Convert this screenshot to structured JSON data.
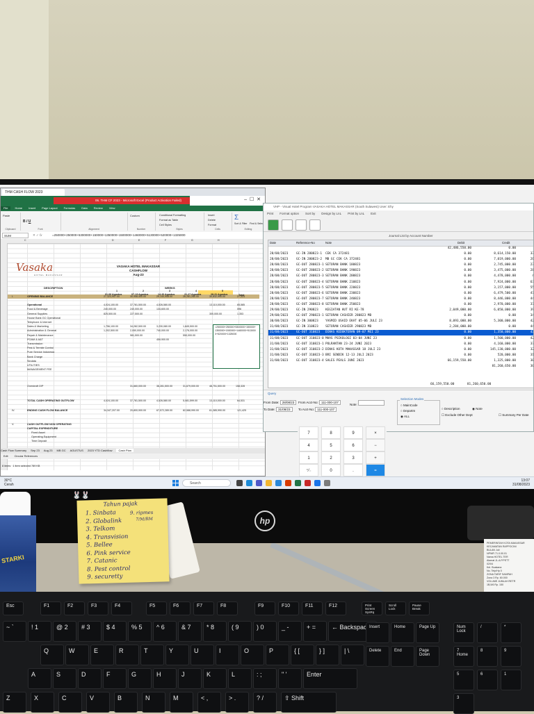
{
  "excel": {
    "tab_title": "THM CASH FLOW 2023",
    "window_title": "06. THM CF 2023 - Microsoft Excel (Product Activation Failed)",
    "ribbon_tabs": [
      "File",
      "Home",
      "Insert",
      "Page Layout",
      "Formulas",
      "Data",
      "Review",
      "View"
    ],
    "ribbon_groups": [
      "Clipboard",
      "Font",
      "Alignment",
      "Number",
      "Styles",
      "Cells",
      "Editing"
    ],
    "ribbon_buttons": {
      "paste": "Paste",
      "conditional": "Conditional Formatting",
      "format_table": "Format as Table",
      "cell_styles": "Cell Styles",
      "insert": "Insert",
      "delete": "Delete",
      "format": "Format",
      "sort": "Sort & Filter",
      "find": "Find & Select",
      "custom": "Custom"
    },
    "name_box": "SUM",
    "formula": "=250000+250000+5300000+150000+1350000+1500000+1460000+5130000+520000+1325000",
    "logo_text": "Vasaka",
    "logo_sub": "HOTEL MAKASSAR",
    "hotel_name": "VASAKA HOTEL MAKASSAR",
    "sheet_title": "CASHFLOW",
    "period": "Aug-23",
    "description_header": "DESCRIPTION",
    "weeks_header": "WEEKS",
    "week_ranges": [
      "01-06 Agustus",
      "07-13 Agustus",
      "14-20 Agustus",
      "21-27 Agustus",
      "28-31 Agustus",
      "Total"
    ],
    "week_numbers": [
      "1",
      "2",
      "3",
      "4",
      "5"
    ],
    "rows": [
      {
        "no": "I.",
        "label": "OPENING BALANCE",
        "v": [
          "27,323,907.00",
          "30,958,400.00",
          "29,140,908.00",
          "28,281,280.00",
          "30,832,990.00",
          "27,323"
        ]
      },
      {
        "no": "",
        "label": "Operational",
        "v": [
          "4,024,100.00",
          "37,781,500.00",
          "4,526,580.00",
          "",
          "13,110,000.00",
          "65,585"
        ]
      },
      {
        "no": "",
        "label": "Food & Beverage",
        "v": [
          "240,000.00",
          "240,000.00",
          "134,600.00",
          "",
          "",
          "596"
        ]
      },
      {
        "no": "",
        "label": "General Supplies",
        "v": [
          "825,500.00",
          "227,500.00",
          "",
          "",
          "300,000.00",
          "1,353"
        ]
      },
      {
        "no": "",
        "label": "House Bank GC Operational",
        "v": [
          "",
          "",
          "",
          "",
          "",
          ""
        ]
      },
      {
        "no": "",
        "label": "Telephone & Internet",
        "v": [
          "",
          "",
          "",
          "",
          "",
          ""
        ]
      },
      {
        "no": "",
        "label": "Sales & Marketing",
        "v": [
          "1,756,100.00",
          "34,282,500.00",
          "3,230,080.00",
          "1,845,500.00",
          "",
          ""
        ]
      },
      {
        "no": "",
        "label": "Administration & General",
        "v": [
          "1,202,500.00",
          "2,050,000.00",
          "740,000.00",
          "2,176,000.00",
          "",
          ""
        ]
      },
      {
        "no": "",
        "label": "Repair & Maintenance",
        "v": [
          "",
          "981,500.00",
          "",
          "550,000.00",
          "",
          ""
        ]
      },
      {
        "no": "",
        "label": "POAM & A&T",
        "v": [
          "",
          "",
          "459,900.00",
          "",
          "",
          ""
        ]
      },
      {
        "no": "",
        "label": "Transmission",
        "v": [
          "",
          "",
          "",
          "",
          "",
          ""
        ]
      },
      {
        "no": "",
        "label": "Pest & Termite Control",
        "v": [
          "",
          "",
          "",
          "",
          "",
          ""
        ]
      },
      {
        "no": "",
        "label": "Pure Service Indonesia",
        "v": [
          "",
          "",
          "",
          "",
          "",
          ""
        ]
      },
      {
        "no": "",
        "label": "Bank Charge",
        "v": [
          "",
          "",
          "",
          "",
          "",
          ""
        ]
      },
      {
        "no": "",
        "label": "Sindata",
        "v": [
          "",
          "",
          "",
          "",
          "",
          ""
        ]
      },
      {
        "no": "",
        "label": "UTILITIES",
        "v": [
          "",
          "",
          "",
          "",
          "",
          ""
        ]
      },
      {
        "no": "",
        "label": "MANAGEMENT FEE",
        "v": [
          "",
          "",
          "",
          "",
          "",
          ""
        ]
      }
    ],
    "cell_overlay": "=250000+250000+5300000+150000+1350000+1500000+1460000+5130000+520000+1325000",
    "overdraft_label": "Overdraft O/P",
    "overdraft_values": [
      "31,660,000.00",
      "38,281,500.00",
      "31,679,000.00",
      "48,751,500.00",
      "158,328"
    ],
    "total_out_label": "TOTAL CASH OPERATING OUTFLOW",
    "total_out_values": [
      "4,024,100.00",
      "37,781,500.00",
      "4,526,580.00",
      "5,081,599.00",
      "13,110,000.00",
      "64,531"
    ],
    "ending_label": "ENDING CASH FLOW BALANCE",
    "ending_no": "IV.",
    "ending_values": [
      "34,347,207.00",
      "20,800,900.00",
      "67,572,289.00",
      "82,588,990.00",
      "61,385,990.00",
      "121,425"
    ],
    "non_op_no": "V.",
    "non_op_lines": [
      "CASH OUTFLOW NON OPERATING",
      "CAPITAL EXPENDITURE",
      "Fixed Asset",
      "Operating Equipment",
      "Time Deposit"
    ],
    "sheet_tabs": [
      "Cash Flow Summary",
      "Sep 23",
      "Aug 23",
      "MB GC",
      "AGUSTUS",
      "2023 YTD Cashflow",
      "Cash Plan"
    ],
    "status_left": "Edit",
    "status_sheets": "Circular References",
    "status_items": "8 items",
    "status_selected": "1 item selected 789 KB"
  },
  "vhp": {
    "title": "VHP - Visual Hotel Program    VASAKA HOTEL MAKASSAR (South Sulawesi) User: Ehy",
    "menu": [
      "Print",
      "Format option",
      "Sort by",
      "Design by LnL",
      "Print by LnL",
      "Exit"
    ],
    "list_title": "Journal List by Account Number",
    "columns": [
      "Date",
      "Reference-No",
      "Note",
      "Debit",
      "Credit"
    ],
    "opening_debit": "42,486,550.00",
    "opening_credit": "0.00",
    "rows": [
      {
        "date": "28/08/2023",
        "ref": "GC-IN 280823-1",
        "note": "CEK CA 372481",
        "debit": "0.00",
        "credit": "8,614,150.00",
        "x": "33"
      },
      {
        "date": "28/08/2023",
        "ref": "GC-IN 280823-2",
        "note": "MB GC CEK CA 372481",
        "debit": "0.00",
        "credit": "7,019,000.00",
        "x": "26"
      },
      {
        "date": "28/08/2023",
        "ref": "GC-OUT 280823-1",
        "note": "SETORAN BANK 180823",
        "debit": "0.00",
        "credit": "2,745,000.00",
        "x": "23"
      },
      {
        "date": "28/08/2023",
        "ref": "GC-OUT 280823-2",
        "note": "SETORAN BANK 190823",
        "debit": "0.00",
        "credit": "3,475,000.00",
        "x": "28"
      },
      {
        "date": "28/08/2023",
        "ref": "GC-OUT 280823-3",
        "note": "SETORAN BANK 200823",
        "debit": "0.00",
        "credit": "4,478,000.00",
        "x": "4"
      },
      {
        "date": "28/08/2023",
        "ref": "GC-OUT 280823-4",
        "note": "SETORAN BANK 210823",
        "debit": "0.00",
        "credit": "7,924,000.00",
        "x": "63"
      },
      {
        "date": "28/08/2023",
        "ref": "GC-OUT 280823-5",
        "note": "SETORAN BANK 220823",
        "debit": "0.00",
        "credit": "3,157,000.00",
        "x": "55"
      },
      {
        "date": "28/08/2023",
        "ref": "GC-OUT 280823-6",
        "note": "SETORAN BANK 230823",
        "debit": "0.00",
        "credit": "6,479,500.00",
        "x": "47"
      },
      {
        "date": "28/08/2023",
        "ref": "GC-OUT 280823-7",
        "note": "SETORAN BANK 240823",
        "debit": "0.00",
        "credit": "8,446,000.00",
        "x": "44"
      },
      {
        "date": "28/08/2023",
        "ref": "GC-OUT 280823-8",
        "note": "SETORAN BANK 250823",
        "debit": "0.00",
        "credit": "2,970,000.00",
        "x": "37"
      },
      {
        "date": "29/08/2023",
        "ref": "GC-IN 290823",
        "note": "KEGIATAN HUT RI KE-78",
        "debit": "2,049,000.00",
        "credit": "6,050,000.00",
        "x": "39"
      },
      {
        "date": "29/08/2023",
        "ref": "GC-OUT 290823-1",
        "note": "SETORAN CASHIER 280823 MB",
        "debit": "0.00",
        "credit": "0.00",
        "x": "34"
      },
      {
        "date": "30/08/2023",
        "ref": "GC-IN 300823",
        "note": "YASMID USAID EKAT 05-06 JULI 23",
        "debit": "8,093,000.00",
        "credit": "5,300,000.00",
        "x": "42"
      },
      {
        "date": "31/08/2023",
        "ref": "GC-IN 310823",
        "note": "SETORAN CASHIER 290823 MB",
        "debit": "2,284,000.00",
        "credit": "0.00",
        "x": "44"
      },
      {
        "date": "31/08/2023",
        "ref": "GC-OUT 310823",
        "note": "DINAS KEDOKTERAN 09-07 MEI 23",
        "debit": "0.00",
        "credit": "1,350,000.00",
        "x": "43",
        "selected": true
      },
      {
        "date": "31/08/2023",
        "ref": "GC-OUT 310823-0",
        "note": "MHAS PSIKOLOGI 03-04 JUNI 23",
        "debit": "0.00",
        "credit": "1,500,000.00",
        "x": "42"
      },
      {
        "date": "31/08/2023",
        "ref": "GC-OUT 310823-1",
        "note": "POLRANTAN 23-24 JUNI 2023",
        "debit": "0.00",
        "credit": "4,160,000.00",
        "x": "37"
      },
      {
        "date": "31/08/2023",
        "ref": "GC-OUT 310823-2",
        "note": "DINAS KOTA MAKASSAR 18 JULI 23",
        "debit": "0.00",
        "credit": "145,130,000.00",
        "x": "32"
      },
      {
        "date": "31/08/2023",
        "ref": "GC-OUT 310823-3",
        "note": "BRI SENDIK 12-13 JULI 2023",
        "debit": "0.00",
        "credit": "520,000.00",
        "x": "31"
      },
      {
        "date": "31/08/2023",
        "ref": "GC-OUT 310823-4",
        "note": "SALES PEALS JUNI 2023",
        "debit": "66,159,550.00",
        "credit": "1,325,000.00",
        "x": "30"
      },
      {
        "date": "",
        "ref": "",
        "note": "",
        "debit": "",
        "credit": "81,260,650.00",
        "x": "30"
      }
    ],
    "total_debit": "66,159,550.00",
    "total_credit": "81,260,650.00",
    "query_title": "Query",
    "from_date_label": "From Date:",
    "from_date": "28/08/23",
    "to_date_label": "To Date:",
    "to_date": "31/08/23",
    "from_acct_label": "From Acct-No:",
    "from_acct": "111-000-107",
    "to_acct_label": "To Acct-No:",
    "to_acct": "111-000-107",
    "note_label": "Note:",
    "selection_modes_label": "Selection Modes",
    "modes": [
      "MainCode",
      "Departm",
      "ALL"
    ],
    "options": [
      "Description",
      "Note",
      "Exclude Other Dept",
      "Summary Per Date"
    ]
  },
  "calculator": {
    "keys": [
      "7",
      "8",
      "9",
      "×",
      "4",
      "5",
      "6",
      "−",
      "1",
      "2",
      "3",
      "+",
      "⁺⁄₋",
      "0",
      ".",
      "="
    ]
  },
  "taskbar": {
    "search": "Search",
    "weather_temp": "30°C",
    "weather_desc": "Cerah",
    "time": "13:07",
    "date": "31/08/2023"
  },
  "monitor_brand": "hp",
  "sticky_note": {
    "title": "Tahun pajak",
    "items": [
      "1. Sinbata",
      "2. Globalink",
      "3. Telkom",
      "4. Transvision",
      "5. Bellee",
      "6. Pink service",
      "7. Catanic",
      "8. Pest control",
      "9. securetty"
    ],
    "side_note": "9. ripmes",
    "side_note2": "7/M/RM"
  },
  "can_label": "STARKI",
  "receipt_lines": [
    "PEMERINTAH KOTA MAKASSAR",
    "KECAMATAN RAPPOCINI",
    "BULAN  Juli",
    "NPWR  71.0.00.01",
    "Nama  HOTEL TER",
    "Alamat  JL.A.P.PETT",
    "02/04",
    "Kel.  Buakana",
    "No. Telp/Hp  0",
    "ZONA  TARIF SAMPAH",
    "Zona 3  Rp. 60.000",
    "VOLUME  JUMLAH RETR",
    "1B,5/6  Rp. 150"
  ],
  "keyboard": {
    "fkeys": [
      "Esc",
      "F1",
      "F2",
      "F3",
      "F4",
      "F5",
      "F6",
      "F7",
      "F8",
      "F9",
      "F10",
      "F11",
      "F12",
      "Print Screen SysRq",
      "Scroll Lock",
      "Pause Break"
    ],
    "row1": [
      "~ `",
      "! 1",
      "@ 2",
      "# 3",
      "$ 4",
      "% 5",
      "^ 6",
      "& 7",
      "* 8",
      "( 9",
      ") 0",
      "_ -",
      "+ =",
      "← Backspace"
    ],
    "row2": [
      "Q",
      "W",
      "E",
      "R",
      "T",
      "Y",
      "U",
      "I",
      "O",
      "P",
      "{ [",
      "} ]",
      "| \\"
    ],
    "row3": [
      "A",
      "S",
      "D",
      "F",
      "G",
      "H",
      "J",
      "K",
      "L",
      ": ;",
      "\" '",
      "Enter"
    ],
    "row4": [
      "Z",
      "X",
      "C",
      "V",
      "B",
      "N",
      "M",
      "< ,",
      "> .",
      "? /",
      "⇧ Shift"
    ],
    "nav": [
      "Insert",
      "Home",
      "Page Up",
      "Delete",
      "End",
      "Page Down"
    ],
    "numpad": [
      "Num Lock",
      "/",
      "*",
      "-",
      "7 Home",
      "8",
      "9",
      "4",
      "5",
      "6",
      "1",
      "2",
      "3"
    ]
  }
}
